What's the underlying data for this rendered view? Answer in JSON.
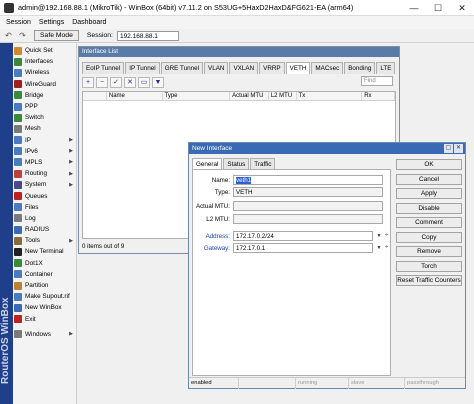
{
  "window": {
    "title": "admin@192.168.88.1 (MikroTik) - WinBox (64bit) v7.11.2 on S53UG+5HaxD2HaxD&FG621-EA (arm64)",
    "controls": [
      "—",
      "☐",
      "✕"
    ]
  },
  "menubar": {
    "items": [
      "Session",
      "Settings",
      "Dashboard"
    ]
  },
  "toolbar": {
    "safe_mode_label": "Safe Mode",
    "session_label": "Session:",
    "session_value": "192.168.88.1"
  },
  "brand": "RouterOS WinBox",
  "sidemenu": {
    "items": [
      {
        "label": "Quick Set",
        "icon": "quick-set-icon",
        "color": "#d08a2a",
        "arrow": false
      },
      {
        "label": "Interfaces",
        "icon": "interfaces-icon",
        "color": "#3a8a3a",
        "arrow": false
      },
      {
        "label": "Wireless",
        "icon": "wireless-icon",
        "color": "#4a7ac0",
        "arrow": false
      },
      {
        "label": "WireGuard",
        "icon": "wireguard-icon",
        "color": "#a02020",
        "arrow": false
      },
      {
        "label": "Bridge",
        "icon": "bridge-icon",
        "color": "#3a8a3a",
        "arrow": false
      },
      {
        "label": "PPP",
        "icon": "ppp-icon",
        "color": "#4a7ac0",
        "arrow": false
      },
      {
        "label": "Switch",
        "icon": "switch-icon",
        "color": "#3a8a3a",
        "arrow": false
      },
      {
        "label": "Mesh",
        "icon": "mesh-icon",
        "color": "#7a7a7a",
        "arrow": false
      },
      {
        "label": "IP",
        "icon": "ip-icon",
        "color": "#4a7ac0",
        "arrow": true
      },
      {
        "label": "IPv6",
        "icon": "ipv6-icon",
        "color": "#4a7ac0",
        "arrow": true
      },
      {
        "label": "MPLS",
        "icon": "mpls-icon",
        "color": "#4a7ac0",
        "arrow": true
      },
      {
        "label": "Routing",
        "icon": "routing-icon",
        "color": "#c04040",
        "arrow": true
      },
      {
        "label": "System",
        "icon": "system-icon",
        "color": "#4a4a8a",
        "arrow": true
      },
      {
        "label": "Queues",
        "icon": "queues-icon",
        "color": "#c02020",
        "arrow": false
      },
      {
        "label": "Files",
        "icon": "files-icon",
        "color": "#4a7ac0",
        "arrow": false
      },
      {
        "label": "Log",
        "icon": "log-icon",
        "color": "#7a7a7a",
        "arrow": false
      },
      {
        "label": "RADIUS",
        "icon": "radius-icon",
        "color": "#3a6ab0",
        "arrow": false
      },
      {
        "label": "Tools",
        "icon": "tools-icon",
        "color": "#8a6a3a",
        "arrow": true
      },
      {
        "label": "New Terminal",
        "icon": "terminal-icon",
        "color": "#222222",
        "arrow": false
      },
      {
        "label": "Dot1X",
        "icon": "dot1x-icon",
        "color": "#3a8a3a",
        "arrow": false
      },
      {
        "label": "Container",
        "icon": "container-icon",
        "color": "#4a7ac0",
        "arrow": false
      },
      {
        "label": "Partition",
        "icon": "partition-icon",
        "color": "#c08030",
        "arrow": false
      },
      {
        "label": "Make Supout.rif",
        "icon": "supout-icon",
        "color": "#4a7ac0",
        "arrow": false
      },
      {
        "label": "New WinBox",
        "icon": "winbox-icon",
        "color": "#3a6ab0",
        "arrow": false
      },
      {
        "label": "Exit",
        "icon": "exit-icon",
        "color": "#c02020",
        "arrow": false
      }
    ],
    "windows_item": {
      "label": "Windows",
      "icon": "windows-icon",
      "color": "#7a7a7a",
      "arrow": true
    }
  },
  "interface_list": {
    "title": "Interface List",
    "tabs": [
      "EoIP Tunnel",
      "IP Tunnel",
      "GRE Tunnel",
      "VLAN",
      "VXLAN",
      "VRRP",
      "VETH",
      "MACsec",
      "Bonding",
      "LTE"
    ],
    "active_tab": "VETH",
    "find_placeholder": "Find",
    "columns": [
      "",
      "Name",
      "Type",
      "Actual MTU",
      "L2 MTU",
      "Tx",
      "Rx"
    ],
    "status": "0 items out of 9"
  },
  "dialog": {
    "title": "New Interface",
    "tabs": [
      "General",
      "Status",
      "Traffic"
    ],
    "active_tab": "General",
    "fields": {
      "name_label": "Name:",
      "name_value": "veth1",
      "type_label": "Type:",
      "type_value": "VETH",
      "actual_mtu_label": "Actual MTU:",
      "actual_mtu_value": "",
      "l2_mtu_label": "L2 MTU:",
      "l2_mtu_value": "",
      "address_label": "Address:",
      "address_value": "172.17.0.2/24",
      "gateway_label": "Gateway:",
      "gateway_value": "172.17.0.1"
    },
    "buttons": [
      "OK",
      "Cancel",
      "Apply",
      "Disable",
      "Comment",
      "Copy",
      "Remove",
      "Torch",
      "Reset Traffic Counters"
    ],
    "status_cells": [
      "enabled",
      "",
      "running",
      "slave",
      "passthrough"
    ]
  }
}
